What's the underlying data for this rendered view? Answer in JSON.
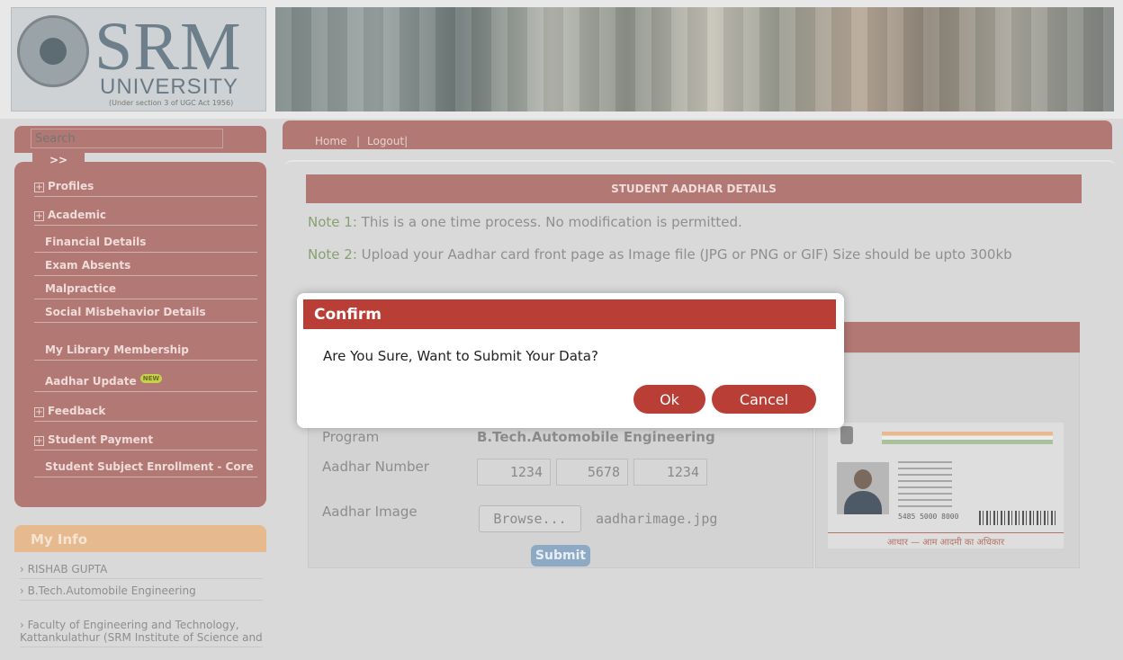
{
  "header": {
    "logo_text": "SRM",
    "logo_university": "UNIVERSITY",
    "logo_subtitle": "(Under section 3 of UGC Act 1956)"
  },
  "sidebar": {
    "search_placeholder": "Search",
    "search_go": ">>",
    "items": [
      {
        "label": "Profiles",
        "expandable": true
      },
      {
        "label": "Academic",
        "expandable": true
      },
      {
        "label": "Financial Details"
      },
      {
        "label": "Exam Absents"
      },
      {
        "label": "Malpractice"
      },
      {
        "label": "Social Misbehavior Details"
      },
      {
        "label": "My Library Membership"
      },
      {
        "label": "Aadhar Update",
        "badge": "NEW"
      },
      {
        "label": "Feedback",
        "expandable": true
      },
      {
        "label": "Student Payment",
        "expandable": true
      },
      {
        "label": "Student Subject Enrollment - Core"
      }
    ]
  },
  "my_info": {
    "title": "My Info",
    "items": [
      "RISHAB GUPTA",
      "B.Tech.Automobile Engineering",
      "Faculty of Engineering and Technology, Kattankulathur (SRM Institute of Science and"
    ]
  },
  "topnav": {
    "home": "Home",
    "separator": "|",
    "logout": "Logout|"
  },
  "main": {
    "section_title": "STUDENT AADHAR DETAILS",
    "note1_label": "Note 1:",
    "note1_text": "This is a one time process. No modification is permitted.",
    "note2_label": "Note 2:",
    "note2_text": "Upload your Aadhar card front page as Image file (JPG or PNG or GIF) Size should be upto 300kb",
    "form": {
      "program_label": "Program",
      "program_value": "B.Tech.Automobile Engineering",
      "aadhar_number_label": "Aadhar Number",
      "aadhar_parts": [
        "1234",
        "5678",
        "1234"
      ],
      "aadhar_image_label": "Aadhar Image",
      "browse_label": "Browse...",
      "file_name": "aadharimage.jpg",
      "submit_label": "Submit"
    },
    "card": {
      "number": "5485 5000 8000",
      "footer": "आधार — आम आदमी का अधिकार"
    }
  },
  "dialog": {
    "title": "Confirm",
    "message": "Are You Sure, Want to Submit Your Data?",
    "ok_label": "Ok",
    "cancel_label": "Cancel"
  },
  "colors": {
    "maroon": "#b27873",
    "dialog_red": "#b93f36",
    "note_green": "#8aa071",
    "submit_blue": "#8da9c4"
  }
}
